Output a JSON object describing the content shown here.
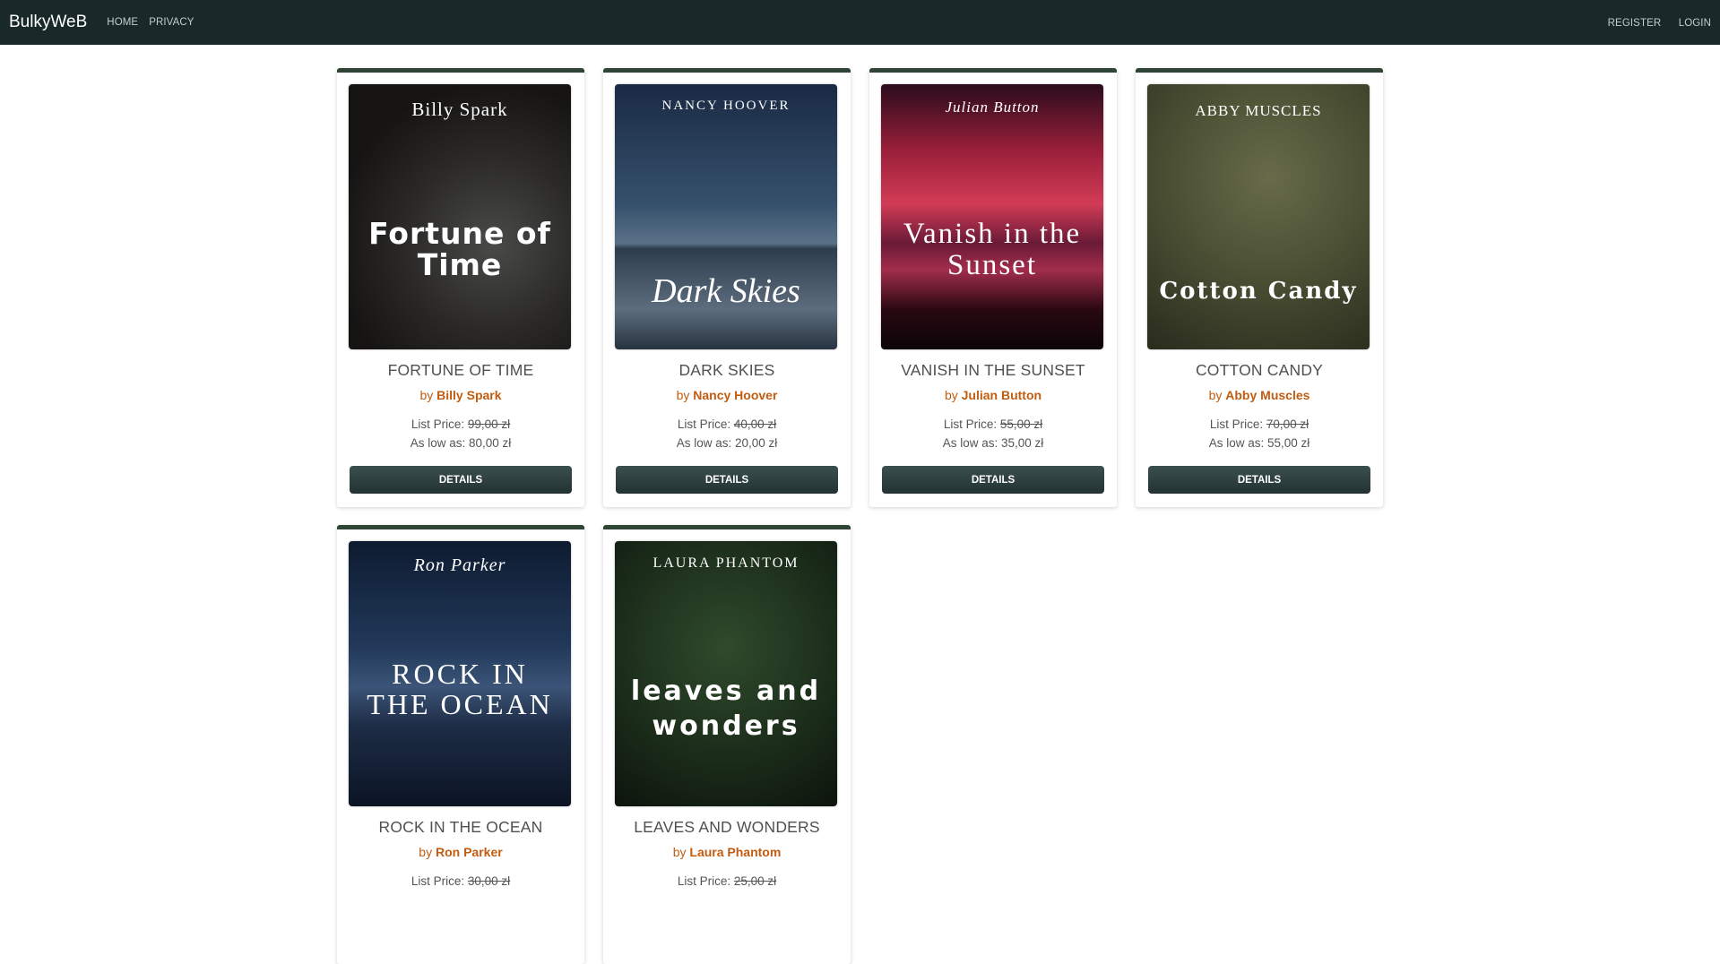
{
  "nav": {
    "brand": "BulkyWeB",
    "links": [
      "HOME",
      "PRIVACY"
    ],
    "right_links": [
      "REGISTER",
      "LOGIN"
    ]
  },
  "labels": {
    "by": "by",
    "list_price": "List Price:",
    "as_low_as": "As low as:",
    "details": "DETAILS"
  },
  "books": [
    {
      "title": "FORTUNE OF TIME",
      "author": "Billy Spark",
      "list_price": "99,00 zł",
      "low_price": "80,00 zł",
      "cover_author": "Billy Spark",
      "cover_title": "Fortune of Time"
    },
    {
      "title": "DARK SKIES",
      "author": "Nancy Hoover",
      "list_price": "40,00 zł",
      "low_price": "20,00 zł",
      "cover_author": "NANCY HOOVER",
      "cover_title": "Dark Skies"
    },
    {
      "title": "VANISH IN THE SUNSET",
      "author": "Julian Button",
      "list_price": "55,00 zł",
      "low_price": "35,00 zł",
      "cover_author": "Julian Button",
      "cover_title": "Vanish in the Sunset"
    },
    {
      "title": "COTTON CANDY",
      "author": "Abby Muscles",
      "list_price": "70,00 zł",
      "low_price": "55,00 zł",
      "cover_author": "ABBY MUSCLES",
      "cover_title": "Cotton Candy"
    },
    {
      "title": "ROCK IN THE OCEAN",
      "author": "Ron Parker",
      "list_price": "30,00 zł",
      "low_price": "",
      "cover_author": "Ron Parker",
      "cover_title": "ROCK IN THE OCEAN"
    },
    {
      "title": "LEAVES AND WONDERS",
      "author": "Laura Phantom",
      "list_price": "25,00 zł",
      "low_price": "",
      "cover_author": "LAURA PHANTOM",
      "cover_title": "leaves and wonders"
    }
  ]
}
